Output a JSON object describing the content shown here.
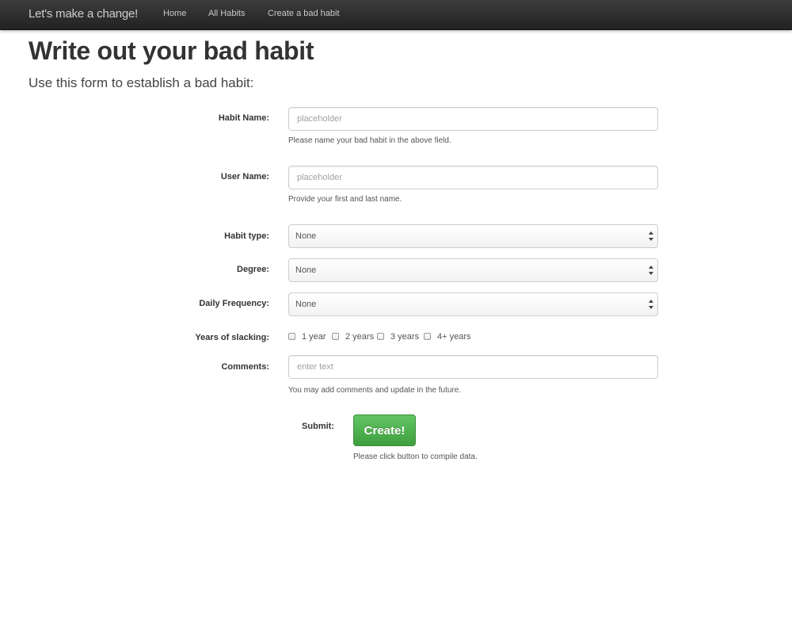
{
  "navbar": {
    "brand": "Let's make a change!",
    "links": [
      "Home",
      "All Habits",
      "Create a bad habit"
    ]
  },
  "page": {
    "title": "Write out your bad habit",
    "subtitle": "Use this form to establish a bad habit:"
  },
  "form": {
    "habit_name": {
      "label": "Habit Name:",
      "placeholder": "placeholder",
      "help": "Please name your bad habit in the above field."
    },
    "user_name": {
      "label": "User Name:",
      "placeholder": "placeholder",
      "help": "Provide your first and last name."
    },
    "habit_type": {
      "label": "Habit type:",
      "value": "None"
    },
    "degree": {
      "label": "Degree:",
      "value": "None"
    },
    "daily_frequency": {
      "label": "Daily Frequency:",
      "value": "None"
    },
    "years_slacking": {
      "label": "Years of slacking:",
      "options": [
        "1 year",
        "2 years",
        "3 years",
        "4+ years"
      ]
    },
    "comments": {
      "label": "Comments:",
      "placeholder": "enter text",
      "help": "You may add comments and update in the future."
    },
    "submit": {
      "label": "Submit:",
      "button": "Create!",
      "help": "Please click button to compile data."
    }
  }
}
